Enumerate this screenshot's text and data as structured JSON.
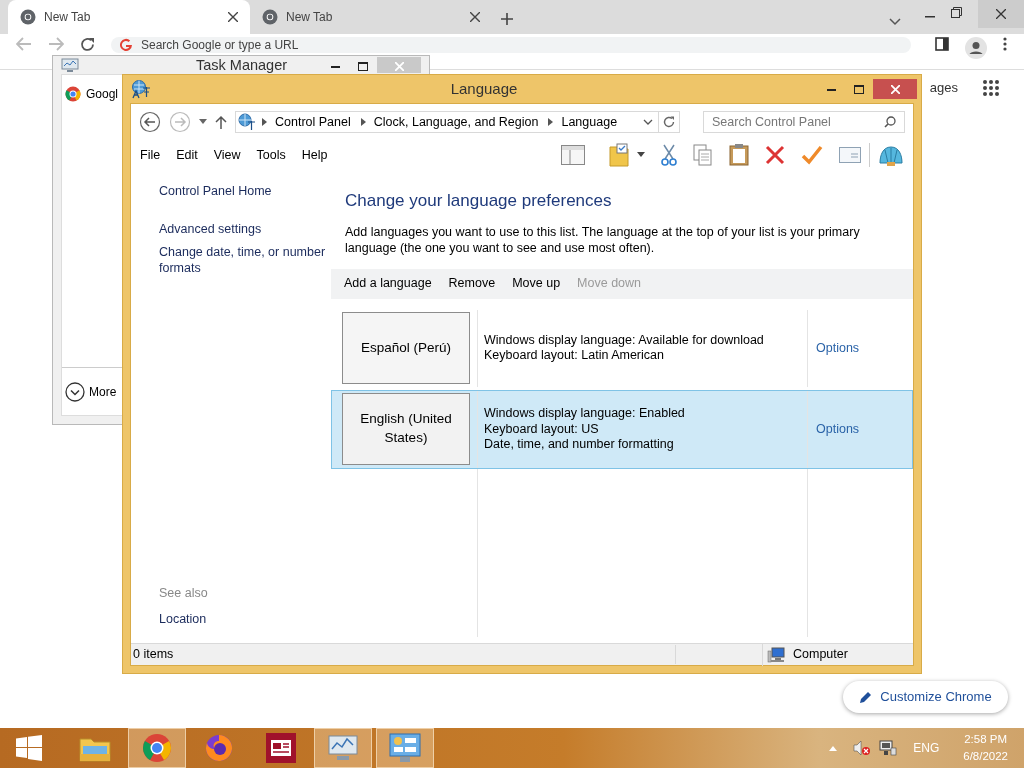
{
  "browser": {
    "tabs": [
      {
        "title": "New Tab",
        "selected": true
      },
      {
        "title": "New Tab",
        "selected": false
      }
    ],
    "address": {
      "placeholder": "Search Google or type a URL"
    },
    "page_link": "ages",
    "customize_button": "Customize Chrome"
  },
  "task_manager": {
    "title": "Task Manager",
    "items": [
      "Googl"
    ],
    "more": "More"
  },
  "language_window": {
    "title": "Language",
    "breadcrumb": [
      "Control Panel",
      "Clock, Language, and Region",
      "Language"
    ],
    "search": {
      "placeholder": "Search Control Panel"
    },
    "menu": [
      "File",
      "Edit",
      "View",
      "Tools",
      "Help"
    ],
    "sidebar": {
      "links": [
        "Control Panel Home",
        "Advanced settings",
        "Change date, time, or number formats"
      ],
      "see_also_heading": "See also",
      "see_also": [
        "Location"
      ]
    },
    "heading": "Change your language preferences",
    "description": "Add languages you want to use to this list. The language at the top of your list is your primary language (the one you want to see and use most often).",
    "actions": [
      {
        "label": "Add a language",
        "disabled": false
      },
      {
        "label": "Remove",
        "disabled": false
      },
      {
        "label": "Move up",
        "disabled": false
      },
      {
        "label": "Move down",
        "disabled": true
      }
    ],
    "languages": [
      {
        "name": "Español (Perú)",
        "details": [
          "Windows display language: Available for download",
          "Keyboard layout: Latin American"
        ],
        "options": "Options",
        "selected": false
      },
      {
        "name": "English (United States)",
        "details": [
          "Windows display language: Enabled",
          "Keyboard layout: US",
          "Date, time, and number formatting"
        ],
        "options": "Options",
        "selected": true
      }
    ],
    "status_bar": {
      "items": "0 items",
      "location": "Computer"
    }
  },
  "taskbar": {
    "apps": [
      {
        "kind": "folder",
        "open": false
      },
      {
        "kind": "chrome",
        "open": true
      },
      {
        "kind": "firefox",
        "open": false
      },
      {
        "kind": "news",
        "open": false
      },
      {
        "kind": "monitor",
        "open": true
      },
      {
        "kind": "panel",
        "open": true
      }
    ],
    "language": "ENG",
    "time": "2:58 PM",
    "date": "6/8/2022"
  }
}
